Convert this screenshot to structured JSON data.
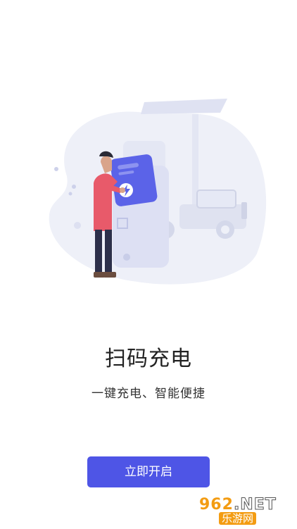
{
  "onboarding": {
    "title": "扫码充电",
    "subtitle": "一键充电、智能便捷",
    "start_button": "立即开启"
  },
  "watermark": {
    "site_number": "962",
    "site_suffix": ".NET",
    "site_name": "乐游网"
  },
  "colors": {
    "accent": "#4e55e6",
    "illustration_bg": "#eef0f8",
    "person_shirt": "#e85a6a",
    "phone_card": "#5b63e8"
  },
  "icons": [
    "lightning-icon"
  ]
}
